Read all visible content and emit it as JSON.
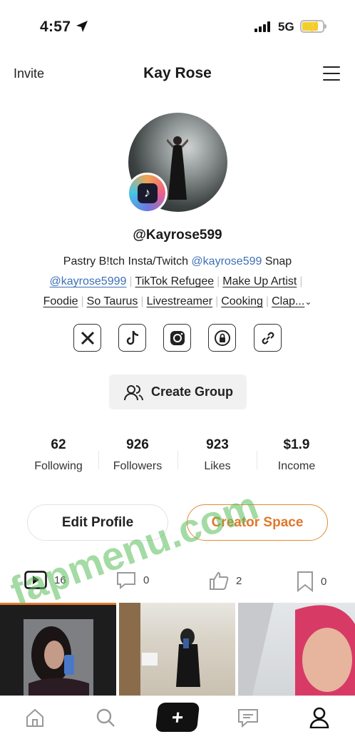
{
  "status_bar": {
    "time": "4:57",
    "network": "5G"
  },
  "header": {
    "invite": "Invite",
    "title": "Kay Rose",
    "menu_icon": "hamburger-icon"
  },
  "profile": {
    "handle": "@Kayrose599",
    "bio": {
      "line1_text": "Pastry B!tch Insta/Twitch ",
      "line1_mention": "@kayrose599",
      "line1_tail": " Snap",
      "line2_mention": "@kayrose5999",
      "line2_tags": [
        "TikTok Refugee",
        "Make Up Artist"
      ],
      "line3_tags": [
        "Foodie",
        "So Taurus",
        "Livestreamer",
        "Cooking",
        "Clap..."
      ]
    }
  },
  "social": [
    "x-icon",
    "tiktok-icon",
    "instagram-icon",
    "onlyfans-icon",
    "link-icon"
  ],
  "create_group": "Create Group",
  "stats": [
    {
      "value": "62",
      "label": "Following"
    },
    {
      "value": "926",
      "label": "Followers"
    },
    {
      "value": "923",
      "label": "Likes"
    },
    {
      "value": "$1.9",
      "label": "Income"
    }
  ],
  "buttons": {
    "edit": "Edit Profile",
    "creator": "Creator Space"
  },
  "content_tabs": [
    {
      "icon": "video-icon",
      "count": "16"
    },
    {
      "icon": "comment-icon",
      "count": "0"
    },
    {
      "icon": "thumbs-up-icon",
      "count": "2"
    },
    {
      "icon": "bookmark-icon",
      "count": "0"
    }
  ],
  "watermark": "fapmenu.com",
  "accent_color": "#e0782a",
  "mention_color": "#3c6fb6"
}
